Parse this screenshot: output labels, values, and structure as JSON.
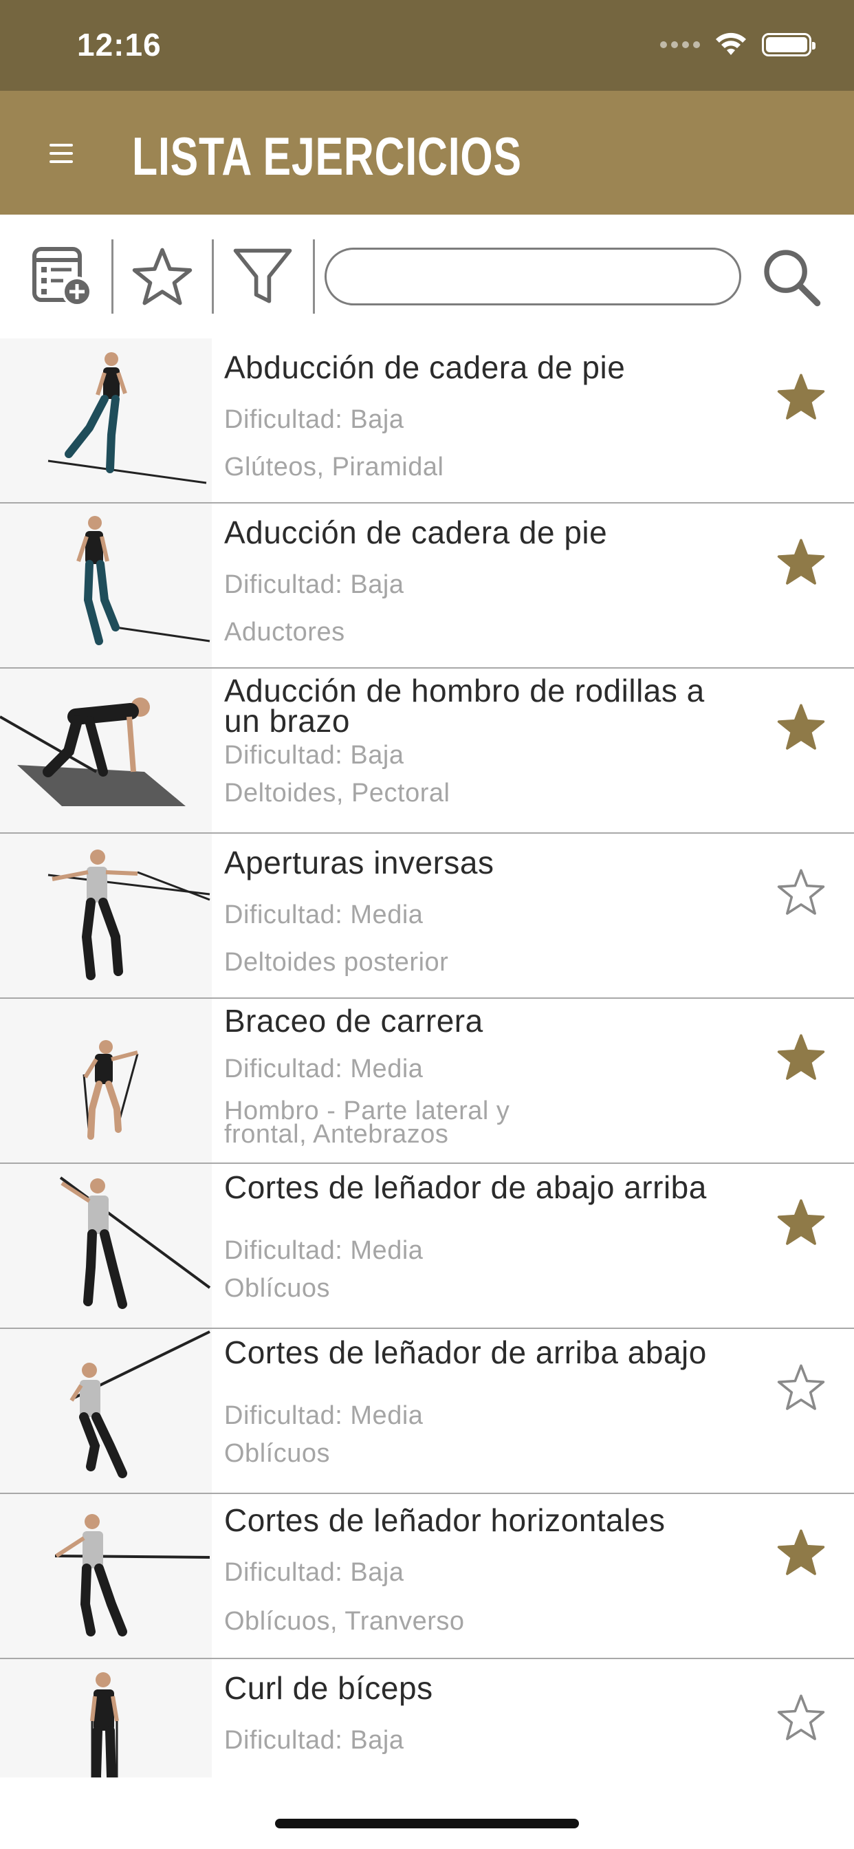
{
  "status_bar": {
    "time": "12:16"
  },
  "header": {
    "title": "LISTA EJERCICIOS"
  },
  "toolbar": {
    "search_value": ""
  },
  "colors": {
    "header_bg": "#9c8553",
    "status_bg": "#756640",
    "accent_star": "#8f7a48"
  },
  "exercises": [
    {
      "title": "Abducción de cadera de pie",
      "difficulty": "Dificultad: Baja",
      "muscles": "Glúteos, Piramidal",
      "favorite": true
    },
    {
      "title": "Aducción de cadera de pie",
      "difficulty": "Dificultad: Baja",
      "muscles": "Aductores",
      "favorite": true
    },
    {
      "title": "Aducción de hombro de rodillas a un brazo",
      "difficulty": "Dificultad: Baja",
      "muscles": "Deltoides, Pectoral",
      "favorite": true
    },
    {
      "title": "Aperturas inversas",
      "difficulty": "Dificultad: Media",
      "muscles": "Deltoides posterior",
      "favorite": false
    },
    {
      "title": "Braceo de carrera",
      "difficulty": "Dificultad: Media",
      "muscles": "Hombro - Parte lateral y frontal, Antebrazos",
      "favorite": true
    },
    {
      "title": "Cortes de leñador de abajo arriba",
      "difficulty": "Dificultad: Media",
      "muscles": "Oblícuos",
      "favorite": true
    },
    {
      "title": "Cortes de leñador de arriba abajo",
      "difficulty": "Dificultad: Media",
      "muscles": "Oblícuos",
      "favorite": false
    },
    {
      "title": "Cortes de leñador horizontales",
      "difficulty": "Dificultad: Baja",
      "muscles": "Oblícuos, Tranverso",
      "favorite": true
    },
    {
      "title": "Curl de bíceps",
      "difficulty": "Dificultad: Baja",
      "muscles": "",
      "favorite": false
    }
  ]
}
